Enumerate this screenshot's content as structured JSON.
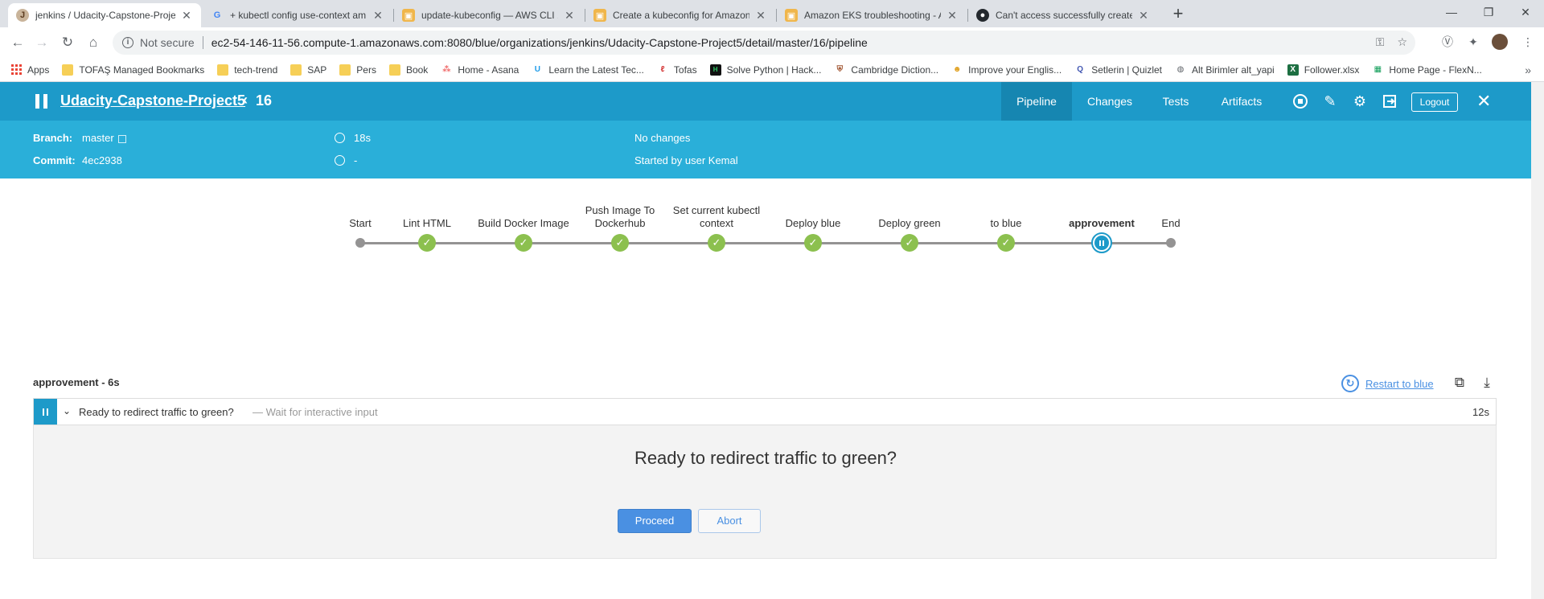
{
  "browser": {
    "tabs": [
      {
        "title": "jenkins / Udacity-Capstone-Proje",
        "active": true
      },
      {
        "title": "+ kubectl config use-context am",
        "active": false
      },
      {
        "title": "update-kubeconfig — AWS CLI 1",
        "active": false
      },
      {
        "title": "Create a kubeconfig for Amazon",
        "active": false
      },
      {
        "title": "Amazon EKS troubleshooting - A",
        "active": false
      },
      {
        "title": "Can't access successfully created",
        "active": false
      }
    ],
    "new_tab": "+",
    "security_label": "Not secure",
    "url": "ec2-54-146-11-56.compute-1.amazonaws.com:8080/blue/organizations/jenkins/Udacity-Capstone-Project5/detail/master/16/pipeline",
    "bookmarks": [
      {
        "label": "Apps",
        "icon": "apps-grid"
      },
      {
        "label": "TOFAŞ Managed Bookmarks",
        "icon": "folder"
      },
      {
        "label": "tech-trend",
        "icon": "folder"
      },
      {
        "label": "SAP",
        "icon": "folder"
      },
      {
        "label": "Pers",
        "icon": "folder"
      },
      {
        "label": "Book",
        "icon": "folder"
      },
      {
        "label": "Home - Asana",
        "icon": "asana"
      },
      {
        "label": "Learn the Latest Tec...",
        "icon": "udemy"
      },
      {
        "label": "Tofas",
        "icon": "tofas"
      },
      {
        "label": "Solve Python | Hack...",
        "icon": "hackerrank"
      },
      {
        "label": "Cambridge Diction...",
        "icon": "cambridge"
      },
      {
        "label": "Improve your Englis...",
        "icon": "person"
      },
      {
        "label": "Setlerin | Quizlet",
        "icon": "quizlet"
      },
      {
        "label": "Alt Birimler alt_yapi",
        "icon": "globe"
      },
      {
        "label": "Follower.xlsx",
        "icon": "excel"
      },
      {
        "label": "Home Page - FlexN...",
        "icon": "sheet"
      }
    ],
    "bookmarks_more": "»"
  },
  "jenkins": {
    "project": "Udacity-Capstone-Project5",
    "run_number": "16",
    "nav": [
      "Pipeline",
      "Changes",
      "Tests",
      "Artifacts"
    ],
    "active_nav": "Pipeline",
    "logout_label": "Logout",
    "branch_label": "Branch:",
    "branch_value": "master",
    "commit_label": "Commit:",
    "commit_value": "4ec2938",
    "duration": "18s",
    "time_ago": "-",
    "changes": "No changes",
    "started_by": "Started by user Kemal",
    "colors": {
      "header": "#1d9ac9",
      "subheader": "#2aafd9",
      "success": "#8cc04f",
      "accent": "#4a90e2"
    }
  },
  "pipeline": {
    "stages": [
      {
        "label": "Start",
        "status": "start"
      },
      {
        "label": "Lint HTML",
        "status": "success"
      },
      {
        "label": "Build Docker Image",
        "status": "success"
      },
      {
        "label": "Push Image To Dockerhub",
        "status": "success"
      },
      {
        "label": "Set current kubectl context",
        "status": "success"
      },
      {
        "label": "Deploy blue",
        "status": "success"
      },
      {
        "label": "Deploy green",
        "status": "success"
      },
      {
        "label": "to blue",
        "status": "success"
      },
      {
        "label": "approvement",
        "status": "paused"
      },
      {
        "label": "End",
        "status": "end"
      }
    ]
  },
  "step": {
    "heading": "approvement - 6s",
    "restart_label": "Restart to blue",
    "title": "Ready to redirect traffic to green?",
    "description": "— Wait for interactive input",
    "duration": "12s",
    "message": "Ready to redirect traffic to green?",
    "proceed_label": "Proceed",
    "abort_label": "Abort"
  }
}
